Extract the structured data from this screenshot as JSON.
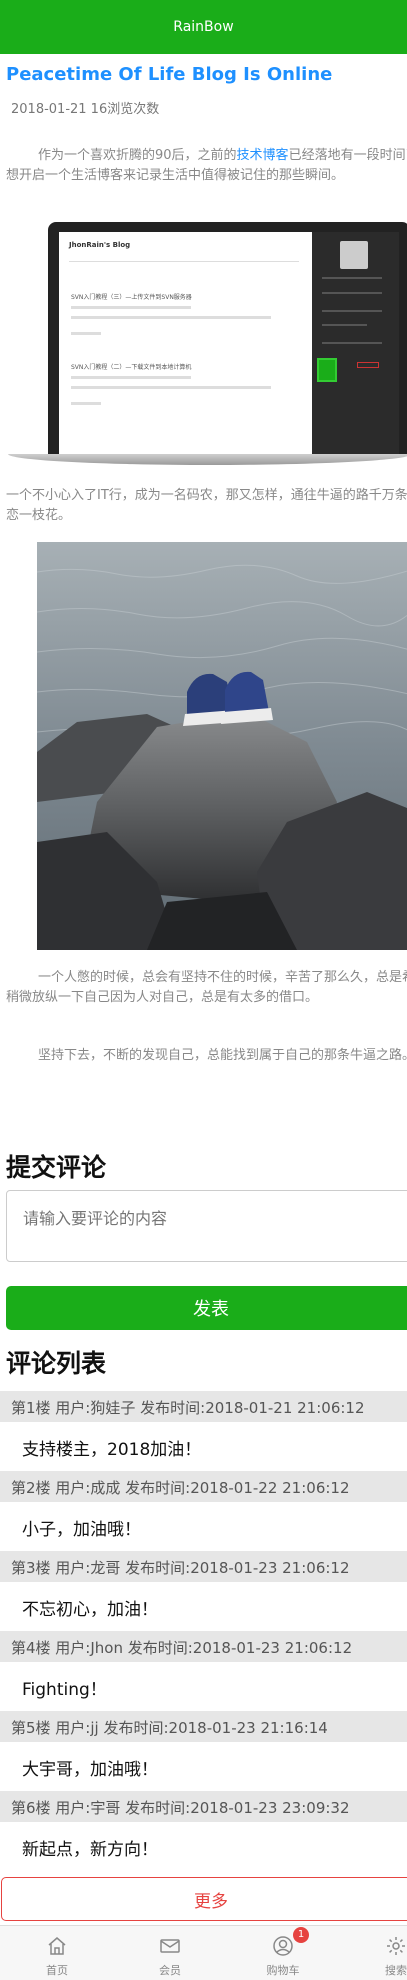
{
  "header": {
    "title": "RainBow"
  },
  "article": {
    "title": "Peacetime Of Life Blog Is Online",
    "meta": "2018-01-21 16浏览次数",
    "p1_before": "作为一个喜欢折腾的90后，之前的",
    "p1_link": "技术博客",
    "p1_after": "已经落地有一段时间了，最近想开启一个生活博客来记录生活中值得被记住的那些瞬间。",
    "p2": "一个不小心入了IT行，成为一名码农，那又怎样，通往牛逼的路千万条，何必单恋一枝花。",
    "p3": "一个人憋的时候，总会有坚持不住的时候，辛苦了那么久，总是希望能够稍微放纵一下自己因为人对自己，总是有太多的借口。",
    "p4": "坚持下去，不断的发现自己，总能找到属于自己的那条牛逼之路。"
  },
  "comment_form": {
    "heading": "提交评论",
    "placeholder": "请输入要评论的内容",
    "submit_label": "发表"
  },
  "comment_list": {
    "heading": "评论列表",
    "items": [
      {
        "meta": "第1楼 用户:狗娃子 发布时间:2018-01-21 21:06:12",
        "text": "支持楼主，2018加油！"
      },
      {
        "meta": "第2楼 用户:成成 发布时间:2018-01-22 21:06:12",
        "text": "小子，加油哦！"
      },
      {
        "meta": "第3楼 用户:龙哥 发布时间:2018-01-23 21:06:12",
        "text": "不忘初心，加油！"
      },
      {
        "meta": "第4楼 用户:Jhon 发布时间:2018-01-23 21:06:12",
        "text": "Fighting！"
      },
      {
        "meta": "第5楼 用户:jj 发布时间:2018-01-23 21:16:14",
        "text": "大宇哥，加油哦！"
      },
      {
        "meta": "第6楼 用户:宇哥 发布时间:2018-01-23 23:09:32",
        "text": "新起点，新方向！"
      }
    ],
    "more_label": "更多"
  },
  "tabbar": {
    "items": [
      {
        "label": "首页",
        "icon": "home-icon"
      },
      {
        "label": "会员",
        "icon": "mail-icon"
      },
      {
        "label": "购物车",
        "icon": "user-icon",
        "badge": "1"
      },
      {
        "label": "搜索",
        "icon": "gear-icon"
      }
    ]
  },
  "colors": {
    "brand_green": "#1aad19",
    "link_blue": "#1e90ff",
    "danger_red": "#e64340"
  }
}
